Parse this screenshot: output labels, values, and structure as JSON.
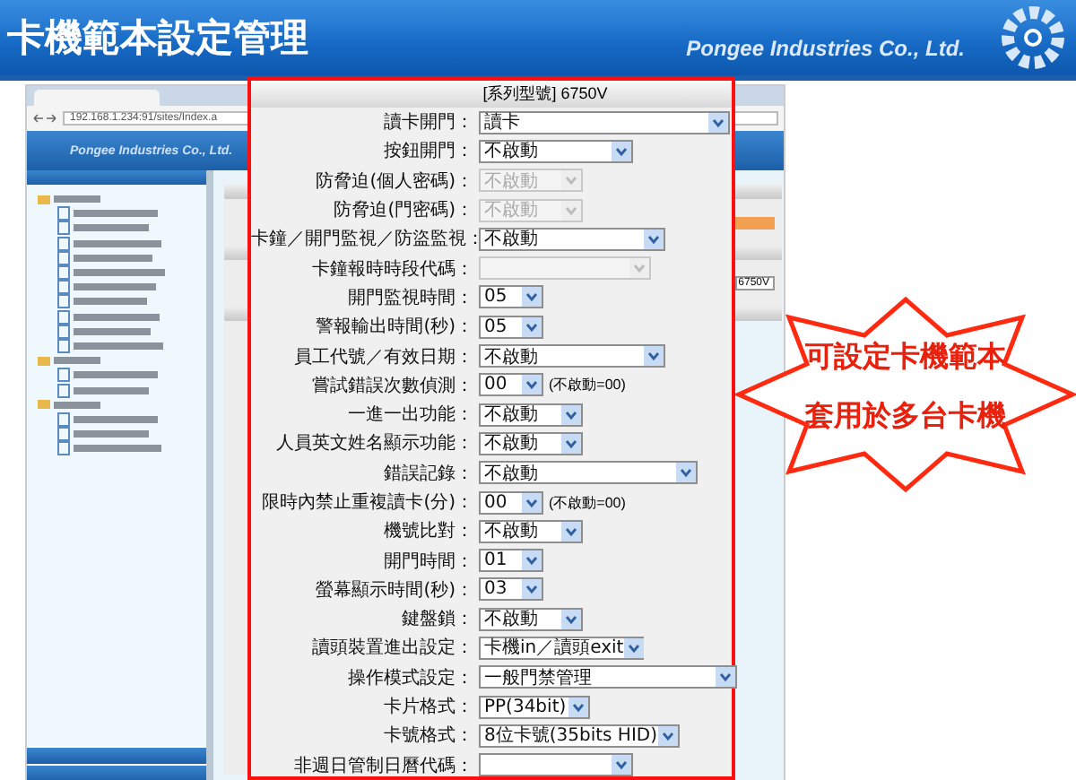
{
  "slide": {
    "title": "卡機範本設定管理",
    "company": "Pongee Industries Co., Ltd."
  },
  "browser": {
    "address": "192.168.1.234:91/sites/Index.a",
    "app_company": "Pongee Industries Co., Ltd.",
    "model_select": "6750V"
  },
  "dialog": {
    "title": "[系列型號] 6750V",
    "rows": [
      {
        "label": "讀卡開門：",
        "value": "讀卡",
        "disabled": false
      },
      {
        "label": "按鈕開門：",
        "value": "不啟動",
        "disabled": false
      },
      {
        "label": "防脅迫(個人密碼)：",
        "value": "不啟動",
        "disabled": true
      },
      {
        "label": "防脅迫(門密碼)：",
        "value": "不啟動",
        "disabled": true
      },
      {
        "label": "卡鐘／開門監視／防盜監視：",
        "value": "不啟動",
        "disabled": false
      },
      {
        "label": "卡鐘報時時段代碼：",
        "value": "",
        "disabled": true
      },
      {
        "label": "開門監視時間：",
        "value": "05",
        "disabled": false
      },
      {
        "label": "警報輸出時間(秒)：",
        "value": "05",
        "disabled": false
      },
      {
        "label": "員工代號／有效日期：",
        "value": "不啟動",
        "disabled": false
      },
      {
        "label": "嘗試錯誤次數偵測：",
        "value": "00",
        "disabled": false,
        "note": "(不啟動=00)"
      },
      {
        "label": "一進一出功能：",
        "value": "不啟動",
        "disabled": false
      },
      {
        "label": "人員英文姓名顯示功能：",
        "value": "不啟動",
        "disabled": false
      },
      {
        "label": "錯誤記錄：",
        "value": "不啟動",
        "disabled": false
      },
      {
        "label": "限時內禁止重複讀卡(分)：",
        "value": "00",
        "disabled": false,
        "note": "(不啟動=00)"
      },
      {
        "label": "機號比對：",
        "value": "不啟動",
        "disabled": false
      },
      {
        "label": "開門時間：",
        "value": "01",
        "disabled": false
      },
      {
        "label": "螢幕顯示時間(秒)：",
        "value": "03",
        "disabled": false
      },
      {
        "label": "鍵盤鎖：",
        "value": "不啟動",
        "disabled": false
      },
      {
        "label": "讀頭裝置進出設定：",
        "value": "卡機in／讀頭exit",
        "disabled": false
      },
      {
        "label": "操作模式設定：",
        "value": "一般門禁管理",
        "disabled": false
      },
      {
        "label": "卡片格式：",
        "value": "PP(34bit)",
        "disabled": false
      },
      {
        "label": "卡號格式：",
        "value": "8位卡號(35bits HID)",
        "disabled": false
      },
      {
        "label": "非週日管制日曆代碼：",
        "value": "",
        "disabled": false
      }
    ]
  },
  "callout": {
    "lines": [
      "可設定卡機範本",
      "套用於多台卡機"
    ]
  }
}
